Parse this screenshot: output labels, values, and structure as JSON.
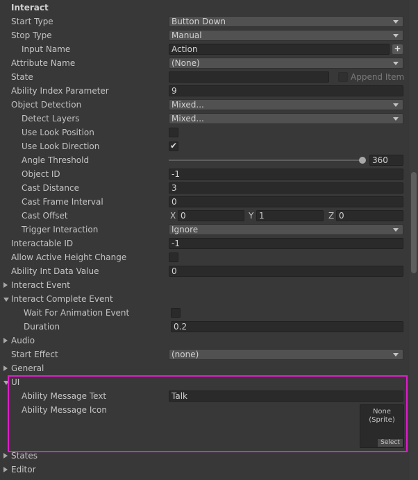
{
  "header": {
    "title": "Interact"
  },
  "start_type": {
    "label": "Start Type",
    "value": "Button Down"
  },
  "stop_type": {
    "label": "Stop Type",
    "value": "Manual"
  },
  "input_name": {
    "label": "Input Name",
    "value": "Action",
    "add_glyph": "+"
  },
  "attribute_name": {
    "label": "Attribute Name",
    "value": "(None)"
  },
  "state": {
    "label": "State",
    "value": "",
    "append_label": "Append Item"
  },
  "ability_index": {
    "label": "Ability Index Parameter",
    "value": "9"
  },
  "object_detection": {
    "label": "Object Detection",
    "value": "Mixed..."
  },
  "detect_layers": {
    "label": "Detect Layers",
    "value": "Mixed..."
  },
  "use_look_position": {
    "label": "Use Look Position",
    "checked": false
  },
  "use_look_direction": {
    "label": "Use Look Direction",
    "checked": true,
    "check_glyph": "✔"
  },
  "angle_threshold": {
    "label": "Angle Threshold",
    "value": "360",
    "slider_fraction": 1.0
  },
  "object_id": {
    "label": "Object ID",
    "value": "-1"
  },
  "cast_distance": {
    "label": "Cast Distance",
    "value": "3"
  },
  "cast_frame_interval": {
    "label": "Cast Frame Interval",
    "value": "0"
  },
  "cast_offset": {
    "label": "Cast Offset",
    "x_label": "X",
    "x": "0",
    "y_label": "Y",
    "y": "1",
    "z_label": "Z",
    "z": "0"
  },
  "trigger_interaction": {
    "label": "Trigger Interaction",
    "value": "Ignore"
  },
  "interactable_id": {
    "label": "Interactable ID",
    "value": "-1"
  },
  "allow_active_height_change": {
    "label": "Allow Active Height Change",
    "checked": false
  },
  "ability_int_data": {
    "label": "Ability Int Data Value",
    "value": "0"
  },
  "interact_event": {
    "label": "Interact Event"
  },
  "interact_complete_event": {
    "label": "Interact Complete Event"
  },
  "wait_for_animation_event": {
    "label": "Wait For Animation Event",
    "checked": false
  },
  "duration": {
    "label": "Duration",
    "value": "0.2"
  },
  "audio": {
    "label": "Audio"
  },
  "start_effect": {
    "label": "Start Effect",
    "value": "(none)"
  },
  "general": {
    "label": "General"
  },
  "ui": {
    "label": "UI"
  },
  "ability_message_text": {
    "label": "Ability Message Text",
    "value": "Talk"
  },
  "ability_message_icon": {
    "label": "Ability Message Icon",
    "value_line1": "None",
    "value_line2": "(Sprite)",
    "select_label": "Select"
  },
  "states": {
    "label": "States"
  },
  "editor": {
    "label": "Editor"
  },
  "colors": {
    "highlight": "#e21ccc",
    "background": "#383838",
    "field": "#2a2a2a",
    "dropdown": "#515151"
  }
}
